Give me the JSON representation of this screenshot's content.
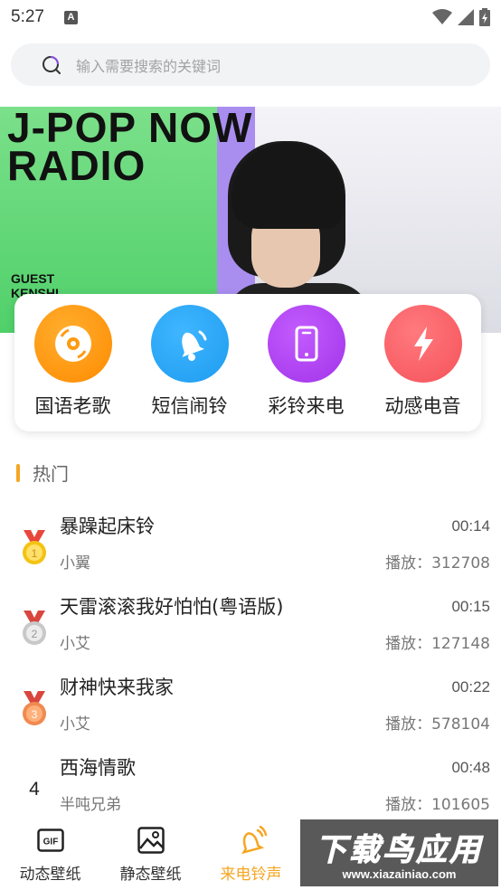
{
  "statusbar": {
    "time": "5:27"
  },
  "search": {
    "placeholder": "输入需要搜索的关键词"
  },
  "banner": {
    "title_line1": "J-POP NOW",
    "title_line2": "RADIO",
    "guest": "GUEST",
    "guest_name": "KENSHI"
  },
  "categories": [
    {
      "label": "国语老歌",
      "icon": "cd-icon",
      "color": "#ff8a00"
    },
    {
      "label": "短信闹铃",
      "icon": "bell-icon",
      "color": "#1e9cf0"
    },
    {
      "label": "彩铃来电",
      "icon": "phone-icon",
      "color": "#a233e8"
    },
    {
      "label": "动感电音",
      "icon": "lightning-icon",
      "color": "#f5525a"
    }
  ],
  "section": {
    "title": "热门"
  },
  "songs": [
    {
      "rank": "1",
      "medal": "gold",
      "name": "暴躁起床铃",
      "artist": "小翼",
      "duration": "00:14",
      "plays": "播放：312708"
    },
    {
      "rank": "2",
      "medal": "silver",
      "name": "天雷滚滚我好怕怕(粤语版)",
      "artist": "小艾",
      "duration": "00:15",
      "plays": "播放：127148"
    },
    {
      "rank": "3",
      "medal": "bronze",
      "name": "财神快来我家",
      "artist": "小艾",
      "duration": "00:22",
      "plays": "播放：578104"
    },
    {
      "rank": "4",
      "medal": "",
      "name": "西海情歌",
      "artist": "半吨兄弟",
      "duration": "00:48",
      "plays": "播放：101605"
    }
  ],
  "tabs": [
    {
      "label": "动态壁纸",
      "icon": "gif-icon",
      "active": false
    },
    {
      "label": "静态壁纸",
      "icon": "image-icon",
      "active": false
    },
    {
      "label": "来电铃声",
      "icon": "ringing-bell-icon",
      "active": true
    }
  ],
  "watermark": {
    "line1": "下载鸟应用",
    "line2": "www.xiazainiao.com"
  },
  "colors": {
    "accent": "#f5a623",
    "gold": "#f3c313",
    "silver": "#c8c8c8",
    "bronze": "#f08a50"
  }
}
